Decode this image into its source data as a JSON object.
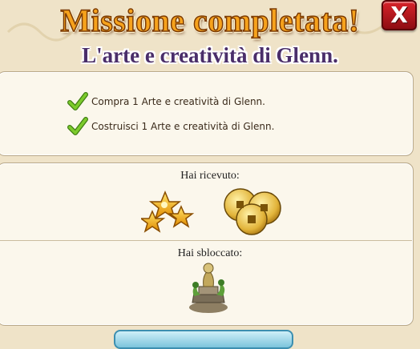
{
  "dialog": {
    "title": "Missione completata!",
    "subtitle": "L'arte e creatività di Glenn.",
    "close_label": "X"
  },
  "tasks": [
    {
      "label": "Compra 1 Arte e creatività di Glenn.",
      "completed": true,
      "icon": "check-icon"
    },
    {
      "label": "Costruisci 1 Arte e creatività di Glenn.",
      "completed": true,
      "icon": "check-icon"
    }
  ],
  "rewards": {
    "received_label": "Hai ricevuto:",
    "items": [
      {
        "icon": "stars-icon"
      },
      {
        "icon": "gold-coins-icon"
      }
    ],
    "unlocked_label": "Hai sbloccato:",
    "unlocked": [
      {
        "icon": "glenn-art-statue-icon"
      }
    ]
  },
  "colors": {
    "title": "#f6a21c",
    "subtitle": "#4a2e6a",
    "close_button": "#c81d24",
    "check": "#6db821",
    "background": "#efe3c8",
    "panel": "#fbf7ec"
  }
}
